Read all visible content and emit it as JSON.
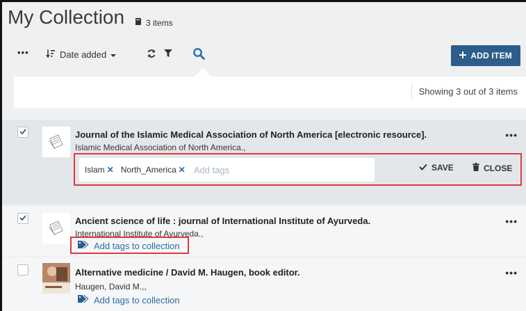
{
  "header": {
    "title": "My Collection",
    "count_label": "3 items"
  },
  "toolbar": {
    "more_label": "•••",
    "sort_label": "Date added",
    "add_item_label": "ADD ITEM"
  },
  "search_panel": {
    "showing_text": "Showing 3 out of 3 items"
  },
  "items": [
    {
      "title": "Journal of the Islamic Medical Association of North America [electronic resource].",
      "author": "Islamic Medical Association of North America.,",
      "checked": true,
      "tags": [
        "Islam",
        "North_America"
      ],
      "tag_placeholder": "Add tags",
      "save_label": "SAVE",
      "close_label": "CLOSE",
      "more_label": "•••"
    },
    {
      "title": "Ancient science of life : journal of International Institute of Ayurveda.",
      "author": "International Institute of Ayurveda.,",
      "checked": true,
      "add_tags_label": "Add tags to collection",
      "more_label": "•••"
    },
    {
      "title": "Alternative medicine / David M. Haugen, book editor.",
      "author": "Haugen, David M.,,",
      "checked": false,
      "add_tags_label": "Add tags to collection",
      "more_label": "•••"
    }
  ],
  "colors": {
    "accent": "#2d5d8a",
    "link": "#2d6ca2",
    "highlight": "#e03a3a",
    "background": "#eef0f2"
  }
}
